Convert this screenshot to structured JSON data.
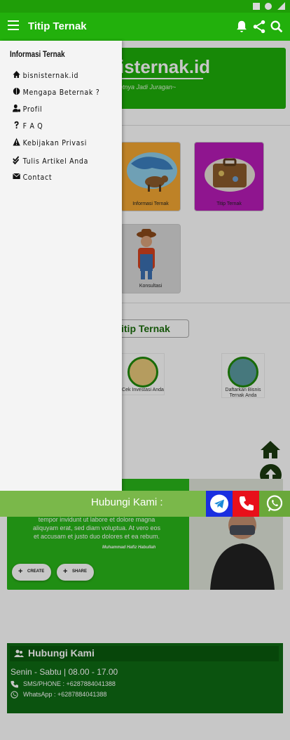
{
  "app": {
    "title": "Titip Ternak"
  },
  "drawer": {
    "heading": "Informasi Ternak",
    "items": [
      {
        "label": "bisnisternak.id",
        "icon": "home-icon"
      },
      {
        "label": "Mengapa Beternak ?",
        "icon": "brain-icon"
      },
      {
        "label": "Profil",
        "icon": "user-gear-icon"
      },
      {
        "label": "F A Q",
        "icon": "question-icon"
      },
      {
        "label": "Kebijakan Privasi",
        "icon": "warning-icon"
      },
      {
        "label": "Tulis Artikel Anda",
        "icon": "check-double-icon"
      },
      {
        "label": "Contact",
        "icon": "envelope-icon"
      }
    ]
  },
  "banner": {
    "title": "isternak.id",
    "subtitle": "etnya Jadi Juragan~"
  },
  "tiles": [
    {
      "label": "Informasi Ternak"
    },
    {
      "label": "Titip Ternak"
    },
    {
      "label": "Konsultasi"
    }
  ],
  "section": {
    "title": "itip Ternak"
  },
  "info_boxes": [
    {
      "label": "Cek Investasi Anda"
    },
    {
      "label": "Daftarkan Bisnis Ternak Anda"
    }
  ],
  "promo": {
    "text_line1": "tempor invidunt ut labore et dolore magna",
    "text_line2": "aliquyam erat, sed diam voluptua. At vero eos",
    "text_line3": "et accusam et justo duo dolores et ea rebum.",
    "author": "Muhammad Hafiz Habullah",
    "create_label": "CREATE",
    "share_label": "SHARE"
  },
  "hubungi_bar": {
    "label": "Hubungi Kami :"
  },
  "contact": {
    "heading": "Hubungi Kami",
    "hours": "Senin - Sabtu | 08.00 - 17.00",
    "phone": "SMS/PHONE : +6287884041388",
    "whatsapp": "WhatsApp : +6287884041388"
  },
  "colors": {
    "appbar": "#22b00c",
    "statusbar": "#1f9e08",
    "telegram": "#1a2fe0",
    "phone": "#e8101a",
    "whatsapp": "#6aa83a",
    "contact_bg": "#0f6b14"
  }
}
